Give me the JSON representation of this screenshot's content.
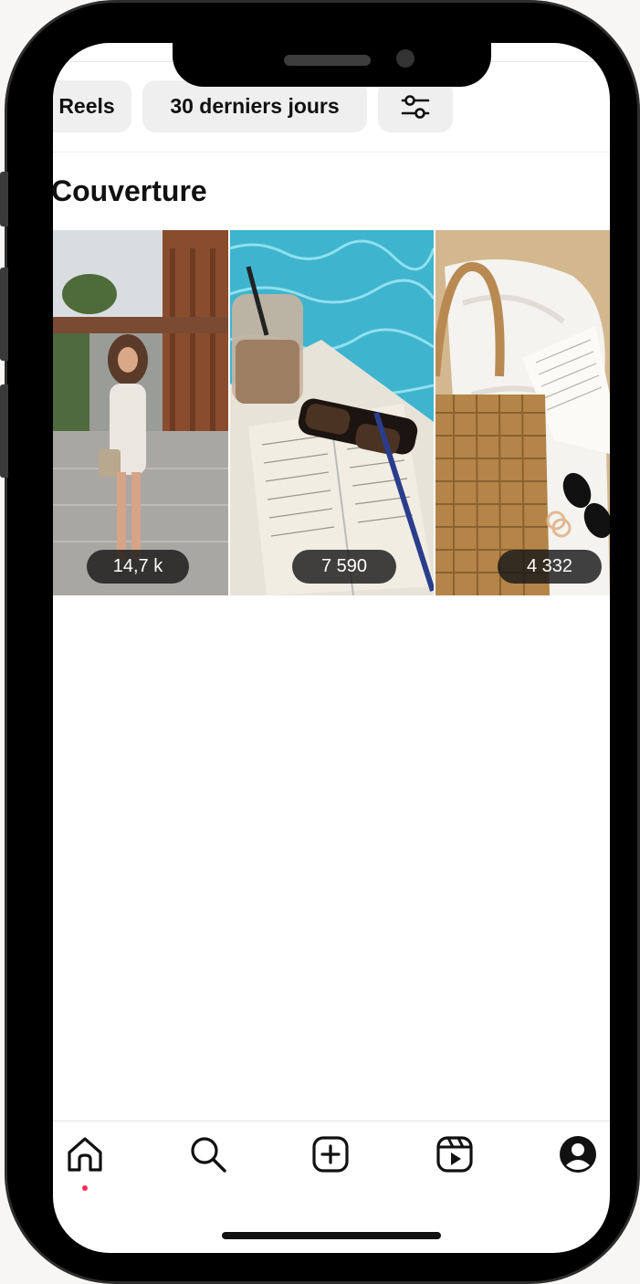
{
  "filters": {
    "reels_label": "Reels",
    "period_label": "30 derniers jours",
    "settings_icon": "sliders-icon"
  },
  "section": {
    "title": "Couverture"
  },
  "thumbnails": [
    {
      "count": "14,7 k",
      "subject": "woman-courtyard-photo"
    },
    {
      "count": "7 590",
      "subject": "pool-book-coffee-photo"
    },
    {
      "count": "4 332",
      "subject": "beach-bag-book-photo"
    }
  ],
  "nav": {
    "items": [
      "home-icon",
      "search-icon",
      "create-icon",
      "reels-icon",
      "profile-icon"
    ],
    "active": "home-icon",
    "notification_color": "#ff2d55"
  }
}
